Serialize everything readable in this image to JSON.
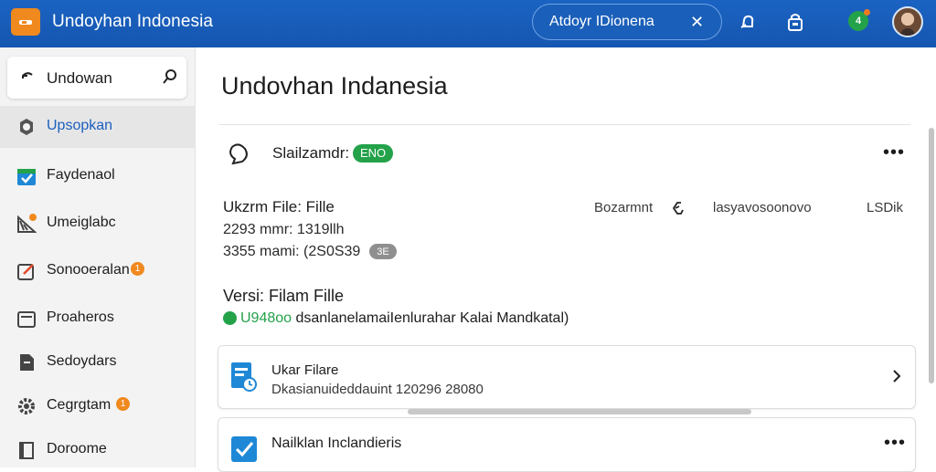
{
  "header": {
    "app_title": "Undoyhan Indonesia",
    "search_value": "Atdoyr IDionena",
    "search_clear": "✕",
    "notification_badge": "4"
  },
  "sidebar": {
    "search_value": "Undowan",
    "items": [
      {
        "label": "Upsopkan",
        "icon": "settings-square-icon",
        "active": true
      },
      {
        "label": "Faydenaol",
        "icon": "calendar-check-icon"
      },
      {
        "label": "Umeiglabc",
        "icon": "striped-tag-icon",
        "dot": true
      },
      {
        "label": "Sonooeralan",
        "icon": "edit-square-icon",
        "badge": "1"
      },
      {
        "label": "Proaheros",
        "icon": "folder-square-icon"
      },
      {
        "label": "Sedoydars",
        "icon": "document-icon"
      },
      {
        "label": "Cegrgtam",
        "icon": "gear-icon",
        "badge": "1"
      },
      {
        "label": "Doroome",
        "icon": "page-icon"
      }
    ]
  },
  "main": {
    "title": "Undovhan Indanesia",
    "section": {
      "name": "Slailzamdr:",
      "status": "ENO",
      "more": "•••"
    },
    "file": {
      "name": "Ukzrm File: Fille",
      "meta1": "2293 mmr: 1319llh",
      "meta2": "3355 mami: (2S0S39",
      "meta_chip": "3E",
      "col1": "Bozarmnt",
      "col2": "lasyavosoonovo",
      "col3": "LSDik"
    },
    "version": {
      "title": "Versi: Filam Fille",
      "prefix": "U948oo",
      "text": " dsanlanelamaiIenlurahar Kalai Mandkatal)"
    },
    "cards": [
      {
        "title": "Ukar Filare",
        "subtitle": "Dkasianuideddauint 120296 28080"
      },
      {
        "title": "Nailklan Inclandieris",
        "more": "•••"
      }
    ]
  },
  "colors": {
    "topbar": "#1556b0",
    "accent_orange": "#f0891e",
    "success_green": "#23a24a",
    "active_link": "#1b5fbe"
  }
}
